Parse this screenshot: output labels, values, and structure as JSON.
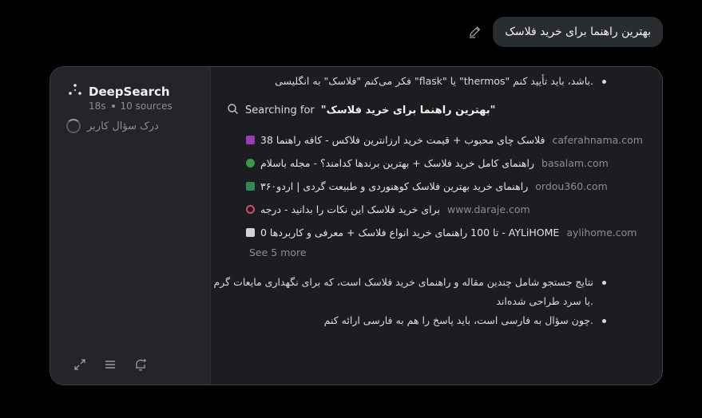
{
  "user_message": {
    "text": "بهترین راهنما برای خرید فلاسک"
  },
  "panel": {
    "title": "DeepSearch",
    "elapsed": "18s",
    "sources": "10 sources",
    "status": "درک سؤال کاربر"
  },
  "content": {
    "bullet_top": ".باشد، باید تأیید کنم \"thermos\" یا \"flask\" فکر می‌کنم \"فلاسک\" به انگلیسی",
    "search_prefix": "Searching for",
    "search_query": "\"بهترین راهنما برای خرید فلاسک\"",
    "results": [
      {
        "title": "فلاسک چای محبوب + قیمت خرید ارزانترین فلاکس - کافه راهنما 38",
        "domain": "caferahnama.com",
        "icon_color": "#9b3bb5"
      },
      {
        "title": "راهنمای کامل خرید فلاسک + بهترین برندها کدامند؟ - مجله باسلام",
        "domain": "basalam.com",
        "icon_color": "#3a9a4a"
      },
      {
        "title": "راهنمای خرید بهترین فلاسک کوهنوردی و طبیعت گردی | اردو۳۶۰",
        "domain": "ordou360.com",
        "icon_color": "#2e8a5a"
      },
      {
        "title": "برای خرید فلاسک این نکات را بدانید - درجه",
        "domain": "www.daraje.com",
        "icon_color": "#d24a6a"
      },
      {
        "title": "AYLiHOME - تا 100 راهنمای خرید انواع فلاسک + معرفی و کاربردها 0",
        "domain": "aylihome.com",
        "icon_color": "#cfd2d8"
      }
    ],
    "see_more": "See 5 more",
    "bullet_2_line1": "نتایج جستجو شامل چندین مقاله و راهنمای خرید فلاسک است، که برای نگهداری مایعات گرم",
    "bullet_2_line2": ".یا سرد طراحی شده‌اند",
    "bullet_3": ".چون سؤال به فارسی است، باید پاسخ را هم به فارسی ارائه کنم"
  },
  "icons": {
    "edit": "pencil-icon",
    "logo": "deepsearch-dots-icon",
    "search": "search-icon",
    "expand": "expand-icon",
    "list": "list-icon",
    "notify": "bell-add-icon"
  }
}
